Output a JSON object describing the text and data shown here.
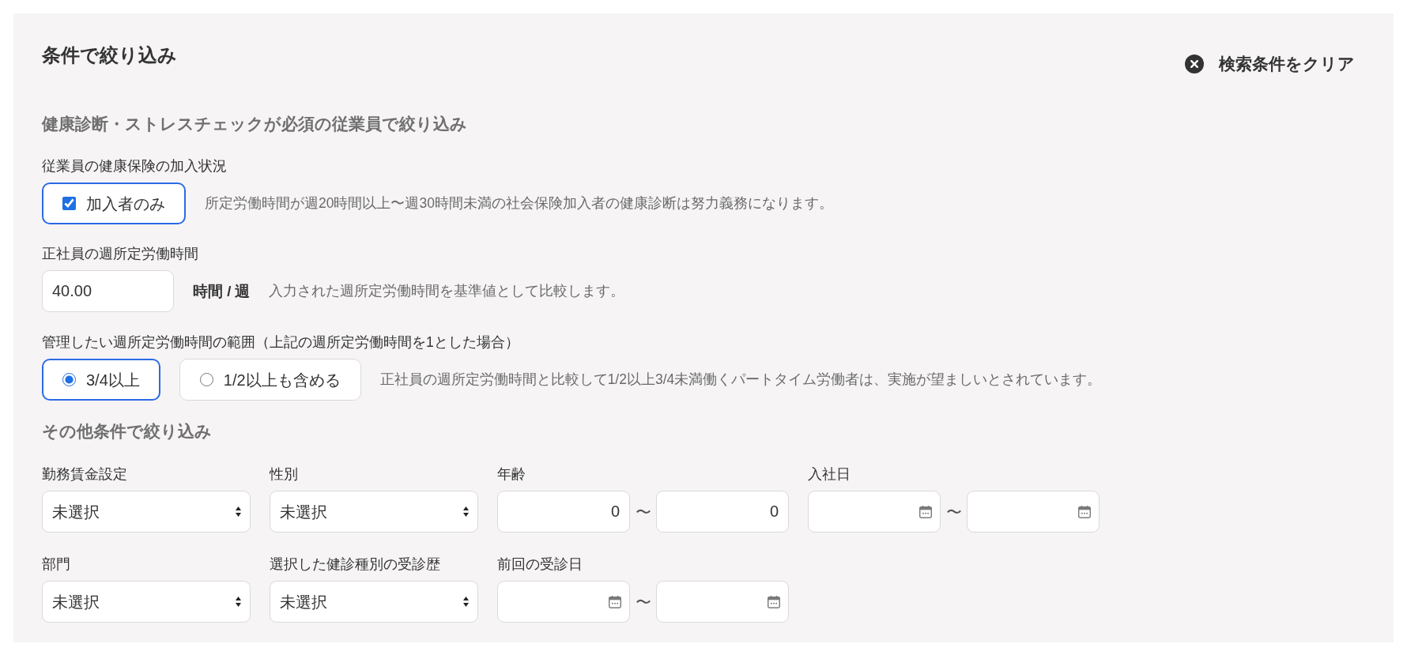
{
  "panel": {
    "title": "条件で絞り込み",
    "clear_button": {
      "label": "検索条件をクリア"
    }
  },
  "required_filter": {
    "heading": "健康診断・ストレスチェックが必須の従業員で絞り込み",
    "insurance": {
      "label": "従業員の健康保険の加入状況",
      "options": [
        {
          "label": "加入者のみ",
          "checked": true
        }
      ],
      "note": "所定労働時間が週20時間以上〜週30時間未満の社会保険加入者の健康診断は努力義務になります。"
    },
    "weekly_hours": {
      "label": "正社員の週所定労働時間",
      "value": "40.00",
      "unit": "時間 / 週",
      "note": "入力された週所定労働時間を基準値として比較します。"
    },
    "hour_range": {
      "label": "管理したい週所定労働時間の範囲（上記の週所定労働時間を1とした場合）",
      "options": [
        {
          "label": "3/4以上",
          "selected": true
        },
        {
          "label": "1/2以上も含める",
          "selected": false
        }
      ],
      "note": "正社員の週所定労働時間と比較して1/2以上3/4未満働くパートタイム労働者は、実施が望ましいとされています。"
    }
  },
  "other_filter": {
    "heading": "その他条件で絞り込み",
    "rows": [
      [
        {
          "kind": "select",
          "label": "勤務賃金設定",
          "value": "未選択"
        },
        {
          "kind": "select",
          "label": "性別",
          "value": "未選択"
        },
        {
          "kind": "number_range",
          "label": "年齢",
          "from": "0",
          "separator": "〜",
          "to": "0"
        },
        {
          "kind": "date_range",
          "label": "入社日",
          "separator": "〜"
        }
      ],
      [
        {
          "kind": "select",
          "label": "部門",
          "value": "未選択"
        },
        {
          "kind": "select",
          "label": "選択した健診種別の受診歴",
          "value": "未選択"
        },
        {
          "kind": "date_range",
          "label": "前回の受診日",
          "separator": "〜"
        }
      ]
    ]
  }
}
